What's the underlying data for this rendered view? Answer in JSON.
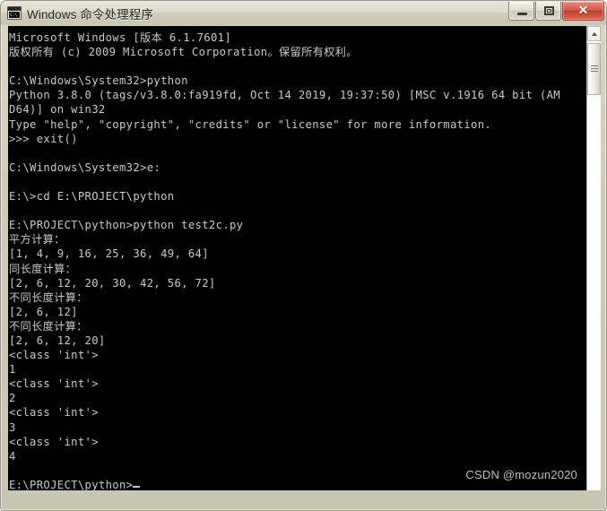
{
  "window": {
    "title": "Windows 命令处理程序",
    "icon_name": "console-icon",
    "icon_text": "C:\\",
    "controls": {
      "minimize_label": "最小化",
      "restore_label": "还原",
      "close_label": "✕"
    },
    "frame_color": "#cfccbb",
    "titlebar_color": "#dedbcc"
  },
  "console": {
    "background_color": "#000000",
    "text_color": "#c8c8c8",
    "lines": [
      "Microsoft Windows [版本 6.1.7601]",
      "版权所有 (c) 2009 Microsoft Corporation。保留所有权利。",
      "",
      "C:\\Windows\\System32>python",
      "Python 3.8.0 (tags/v3.8.0:fa919fd, Oct 14 2019, 19:37:50) [MSC v.1916 64 bit (AM",
      "D64)] on win32",
      "Type \"help\", \"copyright\", \"credits\" or \"license\" for more information.",
      ">>> exit()",
      "",
      "C:\\Windows\\System32>e:",
      "",
      "E:\\>cd E:\\PROJECT\\python",
      "",
      "E:\\PROJECT\\python>python test2c.py",
      "平方计算：",
      "[1, 4, 9, 16, 25, 36, 49, 64]",
      "同长度计算：",
      "[2, 6, 12, 20, 30, 42, 56, 72]",
      "不同长度计算：",
      "[2, 6, 12]",
      "不同长度计算：",
      "[2, 6, 12, 20]",
      "<class 'int'>",
      "1",
      "<class 'int'>",
      "2",
      "<class 'int'>",
      "3",
      "<class 'int'>",
      "4",
      "",
      "E:\\PROJECT\\python>"
    ],
    "prompt_cursor": true
  },
  "scrollbar": {
    "up_arrow_name": "scroll-up-arrow",
    "thumb_name": "scroll-thumb"
  },
  "watermark": {
    "text": "CSDN @mozun2020"
  }
}
